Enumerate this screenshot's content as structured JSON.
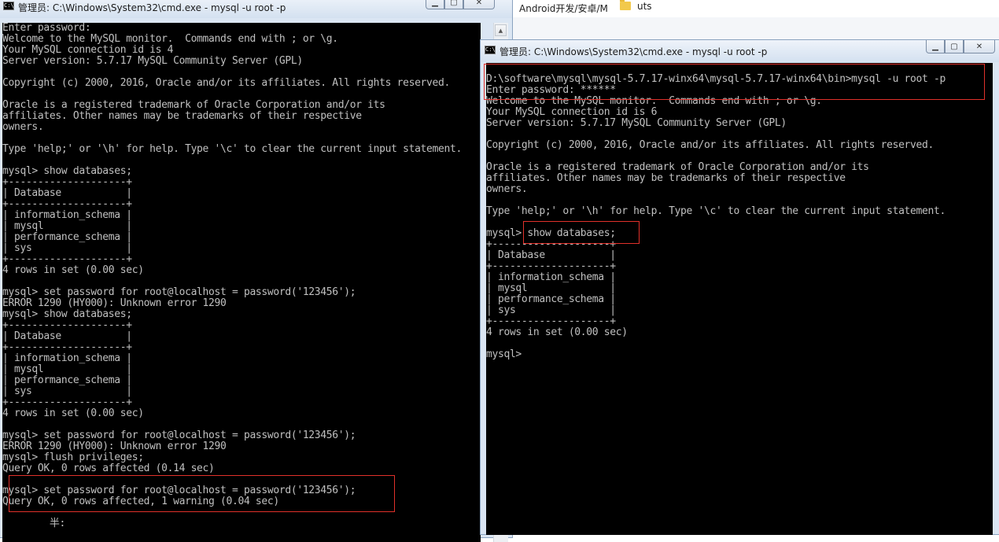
{
  "background_explorer": {
    "crumb": "Android开发/安卓/M",
    "folder_name": "uts"
  },
  "left_window": {
    "title": "管理员: C:\\Windows\\System32\\cmd.exe - mysql  -u root -p",
    "lines": [
      "Enter password:",
      "Welcome to the MySQL monitor.  Commands end with ; or \\g.",
      "Your MySQL connection id is 4",
      "Server version: 5.7.17 MySQL Community Server (GPL)",
      "",
      "Copyright (c) 2000, 2016, Oracle and/or its affiliates. All rights reserved.",
      "",
      "Oracle is a registered trademark of Oracle Corporation and/or its",
      "affiliates. Other names may be trademarks of their respective",
      "owners.",
      "",
      "Type 'help;' or '\\h' for help. Type '\\c' to clear the current input statement.",
      "",
      "mysql> show databases;",
      "+--------------------+",
      "| Database           |",
      "+--------------------+",
      "| information_schema |",
      "| mysql              |",
      "| performance_schema |",
      "| sys                |",
      "+--------------------+",
      "4 rows in set (0.00 sec)",
      "",
      "mysql> set password for root@localhost = password('123456');",
      "ERROR 1290 (HY000): Unknown error 1290",
      "mysql> show databases;",
      "+--------------------+",
      "| Database           |",
      "+--------------------+",
      "| information_schema |",
      "| mysql              |",
      "| performance_schema |",
      "| sys                |",
      "+--------------------+",
      "4 rows in set (0.00 sec)",
      "",
      "mysql> set password for root@localhost = password('123456');",
      "ERROR 1290 (HY000): Unknown error 1290",
      "mysql> flush privileges;",
      "Query OK, 0 rows affected (0.14 sec)",
      "",
      "mysql> set password for root@localhost = password('123456');",
      "Query OK, 0 rows affected, 1 warning (0.04 sec)",
      "",
      "        半:"
    ]
  },
  "right_window": {
    "title": "管理员: C:\\Windows\\System32\\cmd.exe - mysql  -u root -p",
    "lines": [
      "",
      "D:\\software\\mysql\\mysql-5.7.17-winx64\\mysql-5.7.17-winx64\\bin>mysql -u root -p",
      "Enter password: ******",
      "Welcome to the MySQL monitor.  Commands end with ; or \\g.",
      "Your MySQL connection id is 6",
      "Server version: 5.7.17 MySQL Community Server (GPL)",
      "",
      "Copyright (c) 2000, 2016, Oracle and/or its affiliates. All rights reserved.",
      "",
      "Oracle is a registered trademark of Oracle Corporation and/or its",
      "affiliates. Other names may be trademarks of their respective",
      "owners.",
      "",
      "Type 'help;' or '\\h' for help. Type '\\c' to clear the current input statement.",
      "",
      "mysql> show databases;",
      "+--------------------+",
      "| Database           |",
      "+--------------------+",
      "| information_schema |",
      "| mysql              |",
      "| performance_schema |",
      "| sys                |",
      "+--------------------+",
      "4 rows in set (0.00 sec)",
      "",
      "mysql>"
    ]
  },
  "colors": {
    "console_bg": "#000000",
    "console_text": "#c0c0c0",
    "highlight": "#e0302a",
    "titlebar": "#dbe6f3"
  },
  "icons": {
    "minimize": "minimize-icon",
    "maximize": "maximize-icon",
    "close": "close-icon",
    "cmd": "cmd-icon"
  }
}
